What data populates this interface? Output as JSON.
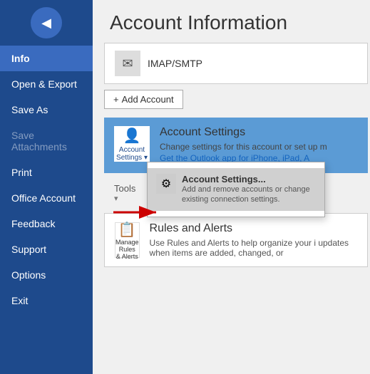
{
  "sidebar": {
    "back_icon": "◀",
    "items": [
      {
        "label": "Info",
        "active": true,
        "disabled": false
      },
      {
        "label": "Open & Export",
        "active": false,
        "disabled": false
      },
      {
        "label": "Save As",
        "active": false,
        "disabled": false
      },
      {
        "label": "Save Attachments",
        "active": false,
        "disabled": true
      },
      {
        "label": "Print",
        "active": false,
        "disabled": false
      },
      {
        "label": "Office Account",
        "active": false,
        "disabled": false
      },
      {
        "label": "Feedback",
        "active": false,
        "disabled": false
      },
      {
        "label": "Support",
        "active": false,
        "disabled": false
      },
      {
        "label": "Options",
        "active": false,
        "disabled": false
      },
      {
        "label": "Exit",
        "active": false,
        "disabled": false
      }
    ]
  },
  "main": {
    "title": "Account Information",
    "imap": {
      "icon": "✉",
      "label": "IMAP/SMTP"
    },
    "add_account_btn": "+ Add Account",
    "account_settings": {
      "icon_emoji": "👤",
      "icon_label": "Account\nSettings ▾",
      "title": "Account Settings",
      "desc": "Change settings for this account or set up m",
      "link": "Get the Outlook app for iPhone, iPad, A"
    },
    "dropdown": {
      "icon_emoji": "⚙",
      "title": "Account Settings...",
      "desc": "Add and remove accounts or\nchange existing connection settings."
    },
    "tools": {
      "label": "Tools"
    },
    "rules": {
      "icon_line1": "Manage Rules",
      "icon_line2": "& Alerts",
      "icon_emoji": "📋",
      "title": "Rules and Alerts",
      "desc": "Use Rules and Alerts to help organize your i\nupdates when items are added, changed, or"
    }
  }
}
